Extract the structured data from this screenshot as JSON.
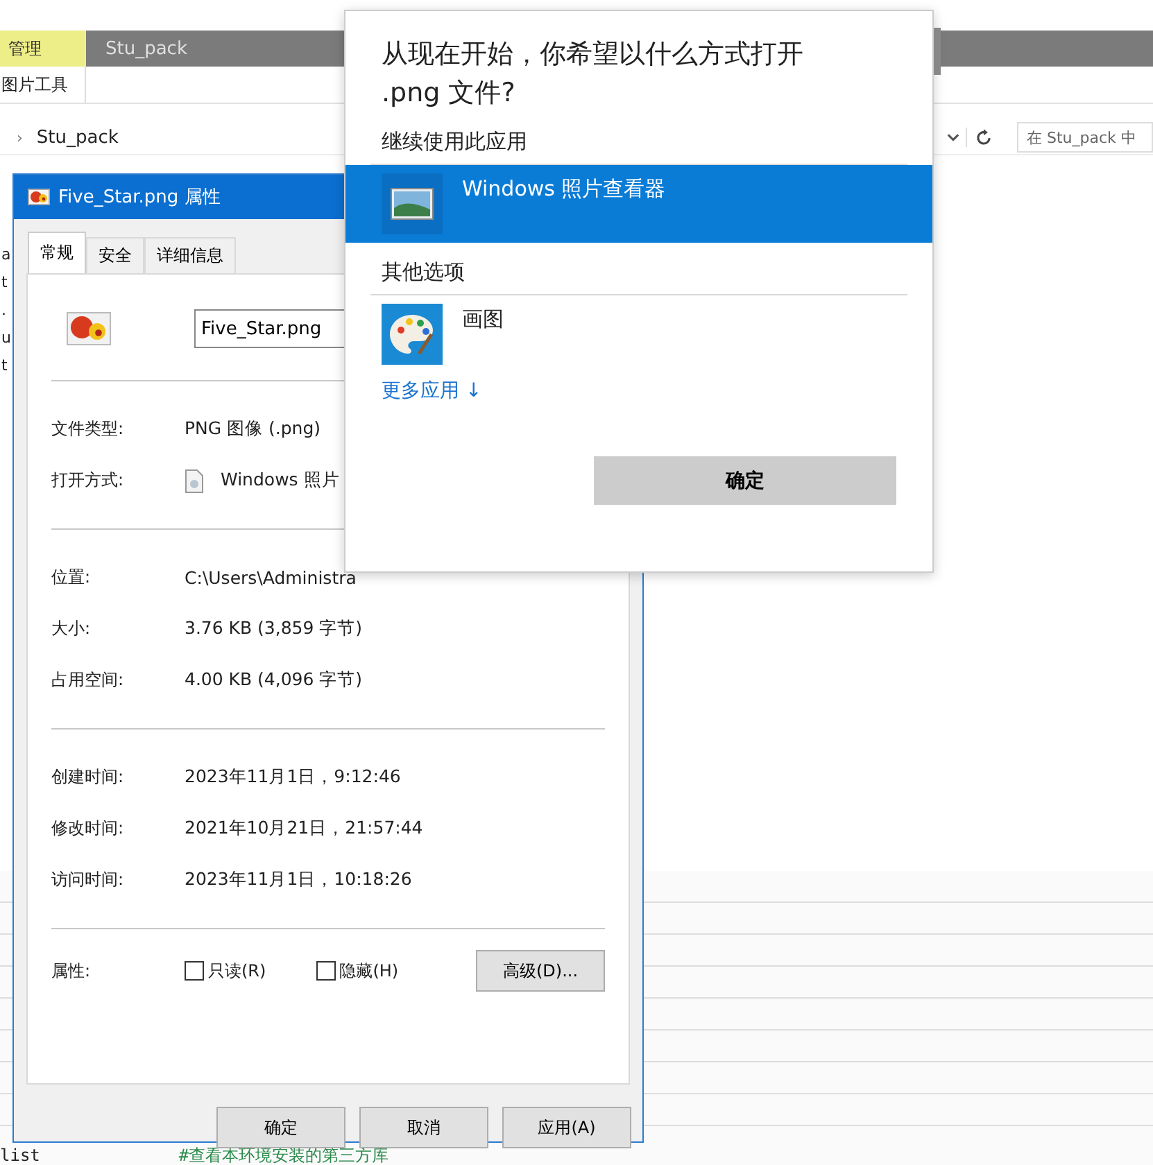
{
  "explorer": {
    "ribbon_tabs": [
      {
        "label": "管理",
        "selected": true
      }
    ],
    "title": "Stu_pack",
    "ribbon_group": "图片工具",
    "breadcrumb": [
      "›",
      "Stu_pack"
    ],
    "search": {
      "placeholder": "在 Stu_pack 中"
    },
    "file_fragments": [
      "a",
      "t",
      ".",
      "u",
      "t"
    ],
    "code_line": {
      "command": "list",
      "comment": "#查看本环境安装的第三方库"
    }
  },
  "properties": {
    "title": "Five_Star.png 属性",
    "tabs": [
      {
        "label": "常规",
        "selected": true
      },
      {
        "label": "安全",
        "selected": false
      },
      {
        "label": "详细信息",
        "selected": false
      }
    ],
    "file_name": "Five_Star.png",
    "groups": [
      [
        {
          "label": "文件类型:",
          "value": "PNG 图像 (.png)",
          "kind": "text"
        },
        {
          "label": "打开方式:",
          "value": "Windows 照片",
          "kind": "app"
        }
      ],
      [
        {
          "label": "位置:",
          "value": "C:\\Users\\Administra",
          "kind": "text"
        },
        {
          "label": "大小:",
          "value": "3.76 KB (3,859 字节)",
          "kind": "text"
        },
        {
          "label": "占用空间:",
          "value": "4.00 KB (4,096 字节)",
          "kind": "text"
        }
      ],
      [
        {
          "label": "创建时间:",
          "value": "2023年11月1日，9:12:46",
          "kind": "text"
        },
        {
          "label": "修改时间:",
          "value": "2021年10月21日，21:57:44",
          "kind": "text"
        },
        {
          "label": "访问时间:",
          "value": "2023年11月1日，10:18:26",
          "kind": "text"
        }
      ]
    ],
    "attributes_label": "属性:",
    "attributes": [
      {
        "label": "只读(R)",
        "checked": false
      },
      {
        "label": "隐藏(H)",
        "checked": false
      }
    ],
    "advanced_button": "高级(D)...",
    "buttons": [
      "确定",
      "取消",
      "应用(A)"
    ]
  },
  "open_with": {
    "question": "从现在开始，你希望以什么方式打开 .png 文件?",
    "sections": [
      {
        "heading": "继续使用此应用",
        "apps": [
          {
            "name": "Windows 照片查看器",
            "kind": "viewer",
            "selected": true
          }
        ]
      },
      {
        "heading": "其他选项",
        "apps": [
          {
            "name": "画图",
            "kind": "paint",
            "selected": false
          }
        ]
      }
    ],
    "more_link": "更多应用 ↓",
    "ok_button": "确定"
  }
}
